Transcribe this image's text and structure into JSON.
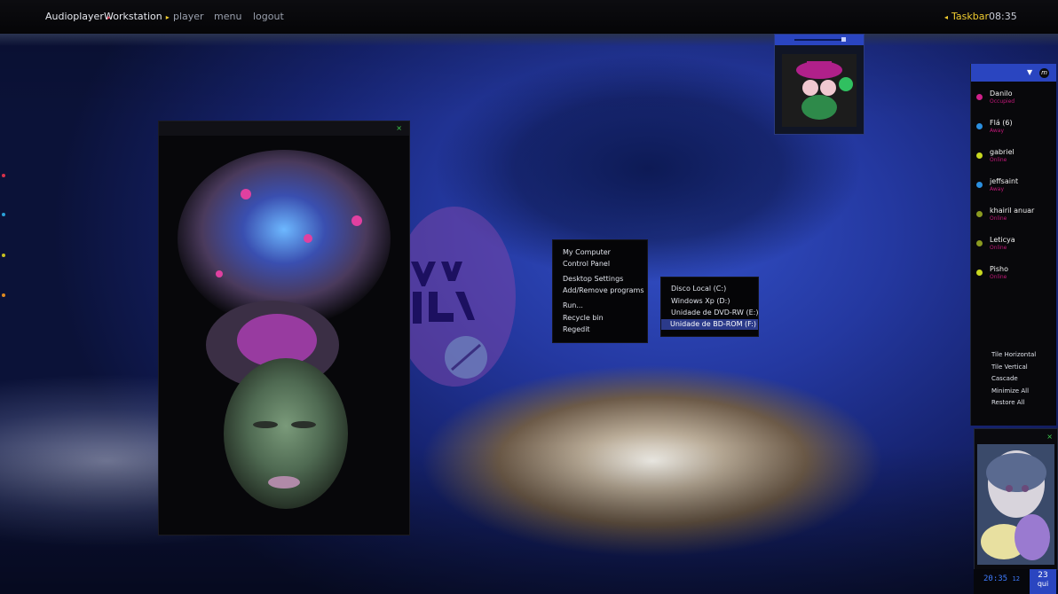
{
  "topbar": {
    "audioplayer": "Audioplayer",
    "workstation": "Workstation",
    "player": "player",
    "menu": "menu",
    "logout": "logout",
    "taskbar": "Taskbar",
    "time": "08:35",
    "arrow_right": "▸",
    "arrow_left": "◂"
  },
  "image_window": {
    "close": "×"
  },
  "context_menu": {
    "items": [
      "My Computer",
      "Control Panel",
      "Desktop Settings",
      "Add/Remove programs",
      "Run...",
      "Recycle bin",
      "Regedit"
    ]
  },
  "drives_menu": {
    "items": [
      "Disco Local (C:)",
      "Windows Xp (D:)",
      "Unidade de DVD-RW (E:)",
      "Unidade de BD-ROM (F:)"
    ],
    "selected_index": 3
  },
  "contacts_panel": {
    "chevron": "▼",
    "badge": "m",
    "contacts": [
      {
        "name": "Danilo",
        "status": "Occupied",
        "dot": "#d0208a",
        "status_color": "#c01878"
      },
      {
        "name": "Flá  (6)",
        "status": "Away",
        "dot": "#2a8fe0",
        "status_color": "#c01878"
      },
      {
        "name": "gabriel",
        "status": "Online",
        "dot": "#c8d820",
        "status_color": "#c01878"
      },
      {
        "name": "jeffsaint",
        "status": "Away",
        "dot": "#2a8fe0",
        "status_color": "#c01878"
      },
      {
        "name": "khairil anuar",
        "status": "Online",
        "dot": "#8a9a20",
        "status_color": "#c01878"
      },
      {
        "name": "Leticya",
        "status": "Online",
        "dot": "#8a9a20",
        "status_color": "#c01878"
      },
      {
        "name": "Pisho",
        "status": "Online",
        "dot": "#c8d820",
        "status_color": "#c01878"
      }
    ]
  },
  "window_ops": [
    "Tile Horizontal",
    "Tile Vertical",
    "Cascade",
    "Minimize All",
    "Restore All"
  ],
  "photo_widget": {
    "close": "×"
  },
  "clock": {
    "time": "20:35",
    "seconds": "12",
    "day": "23",
    "weekday": "qui"
  },
  "colors": {
    "accent": "#2a45c0",
    "taskbar": "#f0cc30",
    "status_pink": "#c01878"
  }
}
